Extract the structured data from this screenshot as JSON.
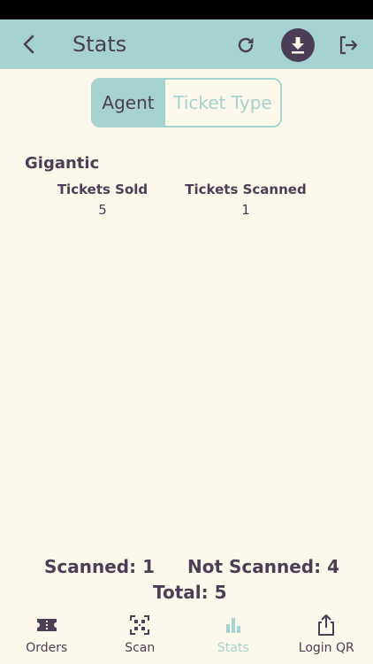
{
  "header": {
    "title": "Stats",
    "icons": {
      "back": "back-arrow-icon",
      "refresh": "refresh-icon",
      "download": "download-icon",
      "logout": "logout-icon"
    }
  },
  "segment": {
    "active_label": "Agent",
    "inactive_label": "Ticket Type"
  },
  "agent": {
    "name": "Gigantic",
    "columns": [
      {
        "header": "Tickets Sold",
        "value": "5"
      },
      {
        "header": "Tickets Scanned",
        "value": "1"
      }
    ]
  },
  "summary": {
    "scanned": "Scanned: 1",
    "not_scanned": "Not Scanned: 4",
    "total": "Total: 5"
  },
  "bottom_nav": {
    "items": [
      {
        "label": "Orders",
        "icon": "ticket-icon"
      },
      {
        "label": "Scan",
        "icon": "qr-scan-icon"
      },
      {
        "label": "Stats",
        "icon": "bar-chart-icon",
        "active": true
      },
      {
        "label": "Login QR",
        "icon": "share-icon"
      }
    ]
  },
  "colors": {
    "accent": "#a6d2d0",
    "text": "#4a3f55",
    "background": "#fdf8ec"
  }
}
